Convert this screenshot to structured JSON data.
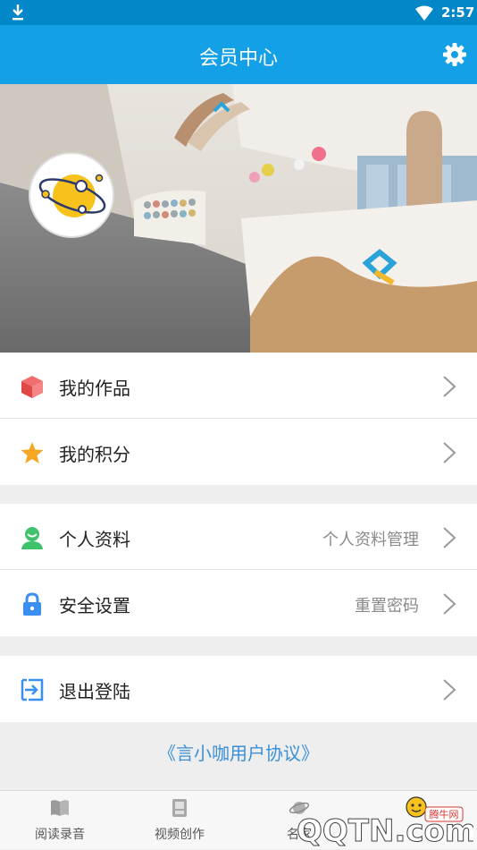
{
  "status": {
    "time": "2:57"
  },
  "appbar": {
    "title": "会员中心"
  },
  "menu_group1": [
    {
      "label": "我的作品",
      "detail": ""
    },
    {
      "label": "我的积分",
      "detail": ""
    }
  ],
  "menu_group2": [
    {
      "label": "个人资料",
      "detail": "个人资料管理"
    },
    {
      "label": "安全设置",
      "detail": "重置密码"
    }
  ],
  "menu_group3": [
    {
      "label": "退出登陆",
      "detail": ""
    }
  ],
  "agreement": "《言小咖用户协议》",
  "tabs": [
    {
      "label": "阅读录音"
    },
    {
      "label": "视频创作"
    },
    {
      "label": "名家"
    },
    {
      "label": ""
    }
  ],
  "watermark": {
    "brand": "QQTN.com",
    "badge": "腾牛网"
  },
  "colors": {
    "primary": "#13a0e6",
    "statusbar": "#0288c9",
    "link": "#3a8fd6"
  }
}
